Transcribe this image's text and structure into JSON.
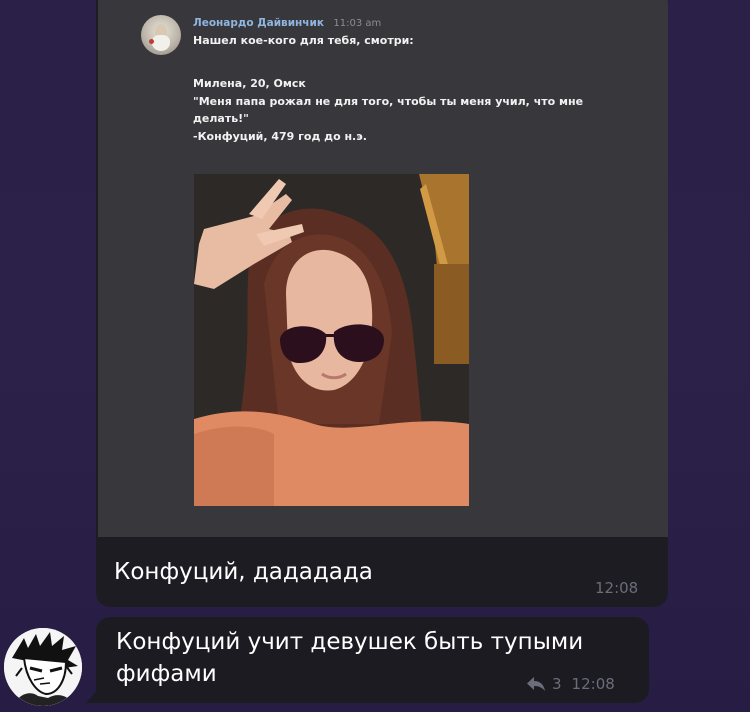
{
  "quoted": {
    "author": "Леонардо Дайвинчик",
    "time": "11:03 am",
    "lines": [
      "Нашел кое-кого для тебя, смотри:",
      "Милена, 20, Омск",
      "\"Меня папа рожал не для того, чтобы ты меня учил, что мне",
      "делать!\"",
      "-Конфуций, 479 год до н.э."
    ],
    "photo_icon": "selfie-photo"
  },
  "outgoing": {
    "text": "Конфуций, дададада",
    "time": "12:08"
  },
  "incoming": {
    "text": "Конфуций учит девушек быть тупыми фифами",
    "reply_count": "3",
    "time": "12:08",
    "avatar_icon": "manga-character-avatar",
    "reply_icon": "reply-arrow-icon"
  },
  "colors": {
    "chat_background": "#2a2048",
    "bubble": "#1c1b22",
    "screenshot_bg": "#37373c",
    "author_name": "#8fb6e0",
    "meta_text": "#6b6d7a"
  }
}
